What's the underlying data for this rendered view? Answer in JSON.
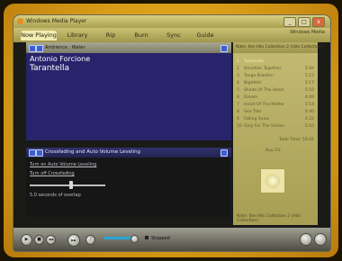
{
  "window": {
    "title": "Windows Media Player",
    "minimize": "_",
    "maximize": "□",
    "close": "x"
  },
  "nav": {
    "tabs": [
      "Now Playing",
      "Library",
      "Rip",
      "Burn",
      "Sync",
      "Guide"
    ],
    "active": "Now Playing",
    "logo": "Windows Media"
  },
  "visualization": {
    "label": "Ambience : Water",
    "artist": "Antonio Forcione",
    "track": "Tarantella"
  },
  "enhancements": {
    "header": "Crossfading and Auto Volume Leveling",
    "auto_volume_link": "Turn on Auto Volume Leveling",
    "crossfading_link": "Turn off Crossfading",
    "overlap_text": "5.0 seconds of overlap",
    "overlap_seconds": 5.0
  },
  "playlist": {
    "header": "Nate: the Hits Collection 2 (Hits Collection)",
    "items": [
      {
        "num": "1",
        "title": "Tarantella",
        "duration": "",
        "playing": true
      },
      {
        "num": "2",
        "title": "Devotion Together",
        "duration": "5:44"
      },
      {
        "num": "3",
        "title": "Tango Brazilen",
        "duration": "5:12"
      },
      {
        "num": "4",
        "title": "Nightfall",
        "duration": "5:17"
      },
      {
        "num": "5",
        "title": "Shade Of The Heart",
        "duration": "5:10"
      },
      {
        "num": "6",
        "title": "Dream",
        "duration": "4:09"
      },
      {
        "num": "7",
        "title": "Heart Of The Matter",
        "duration": "5:14"
      },
      {
        "num": "8",
        "title": "Sea Tide",
        "duration": "4:40"
      },
      {
        "num": "9",
        "title": "Falling Snow",
        "duration": "4:22"
      },
      {
        "num": "10",
        "title": "Only For The Smiles",
        "duration": "5:03"
      }
    ],
    "total_time": "Total Time: 53:41",
    "buy_cd": "Buy CD",
    "footer": "Nate: the Hits Collection 2 (Hits Collection)"
  },
  "controls": {
    "status": "Stopped",
    "progress": 0.12,
    "play": "▶",
    "stop": "■",
    "prev": "◀◀",
    "next": "▶▶",
    "mute": "♪"
  },
  "colors": {
    "frame": "#e3a91c",
    "viz_bg": "#27246b",
    "panel": "#c4ba72"
  }
}
